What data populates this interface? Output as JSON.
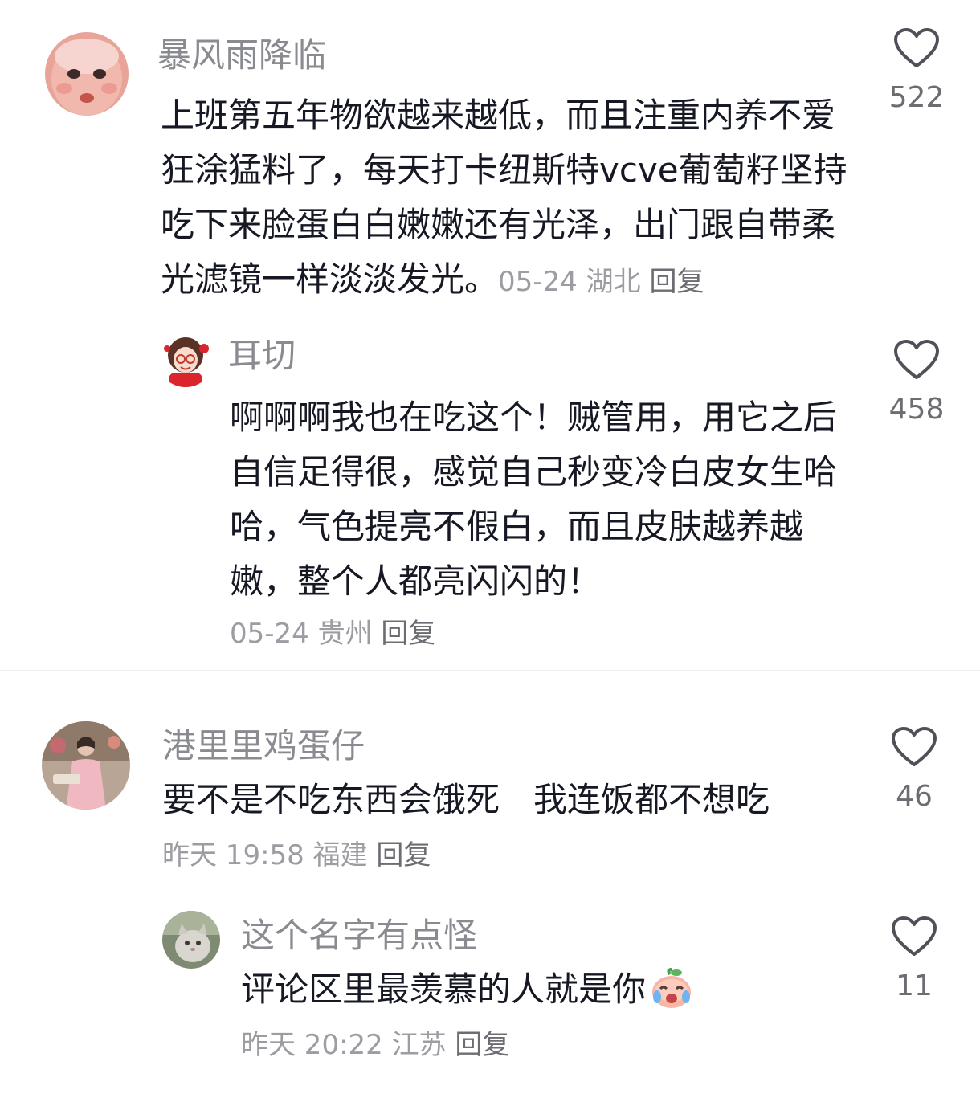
{
  "comments": [
    {
      "user": "暴风雨降临",
      "text": "上班第五年物欲越来越低，而且注重内养不爱狂涂猛料了，每天打卡纽斯特vcve葡萄籽坚持吃下来脸蛋白白嫩嫩还有光泽，出门跟自带柔光滤镜一样淡淡发光。",
      "date": "05-24",
      "location": "湖北",
      "reply_label": "回复",
      "likes": "522",
      "avatar_icon": "baby-face-avatar-icon"
    },
    {
      "user": "耳切",
      "text": "啊啊啊我也在吃这个！贼管用，用它之后自信足得很，感觉自己秒变冷白皮女生哈哈，气色提亮不假白，而且皮肤越养越嫩，整个人都亮闪闪的！",
      "date": "05-24",
      "location": "贵州",
      "reply_label": "回复",
      "likes": "458",
      "avatar_icon": "cartoon-girl-avatar-icon"
    },
    {
      "user": "港里里鸡蛋仔",
      "text": "要不是不吃东西会饿死　我连饭都不想吃",
      "date": "昨天 19:58",
      "location": "福建",
      "reply_label": "回复",
      "likes": "46",
      "avatar_icon": "woman-in-pink-dress-avatar-icon"
    },
    {
      "user": "这个名字有点怪",
      "text": "评论区里最羡慕的人就是你",
      "emoji": "crying-peach-emoji-icon",
      "date": "昨天 20:22",
      "location": "江苏",
      "reply_label": "回复",
      "likes": "11",
      "avatar_icon": "cat-photo-avatar-icon"
    }
  ],
  "icons": {
    "like": "heart-outline-icon"
  },
  "colors": {
    "username": "#8a8b91",
    "text": "#161823",
    "meta": "#9c9da3",
    "divider": "#f0f0f2"
  }
}
